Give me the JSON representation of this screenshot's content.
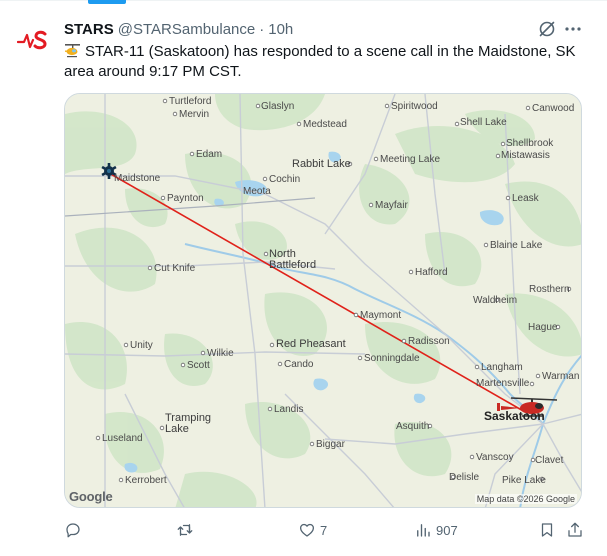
{
  "tweet": {
    "display_name": "STARS",
    "handle": "@STARSambulance",
    "separator": "·",
    "time": "10h",
    "text": "STAR-11 (Saskatoon) has responded to a scene call in the Maidstone, SK area around 9:17 PM CST.",
    "brand_color": "#e31b23"
  },
  "map": {
    "places": {
      "turtleford": "Turtleford",
      "mervin": "Mervin",
      "glaslyn": "Glaslyn",
      "spiritwood": "Spiritwood",
      "canwood": "Canwood",
      "medstead": "Medstead",
      "shell_lake": "Shell Lake",
      "shellbrook": "Shellbrook",
      "mistawasis": "Mistawasis",
      "edam": "Edam",
      "rabbit_lake": "Rabbit Lake",
      "meeting_lake": "Meeting Lake",
      "maidstone": "Maidstone",
      "cochin": "Cochin",
      "meota": "Meota",
      "paynton": "Paynton",
      "mayfair": "Mayfair",
      "leask": "Leask",
      "north_battleford": "North\nBattleford",
      "blaine_lake": "Blaine Lake",
      "cut_knife": "Cut Knife",
      "hafford": "Hafford",
      "rosthern": "Rosthern",
      "waldheim": "Waldheim",
      "maymont": "Maymont",
      "hague": "Hague",
      "radisson": "Radisson",
      "unity": "Unity",
      "wilkie": "Wilkie",
      "red_pheasant": "Red Pheasant",
      "sonningdale": "Sonningdale",
      "scott": "Scott",
      "cando": "Cando",
      "langham": "Langham",
      "martensville": "Martensville",
      "warman": "Warman",
      "landis": "Landis",
      "saskatoon": "Saskatoon",
      "asquith": "Asquith",
      "tramping_lake": "Tramping\nLake",
      "luseland": "Luseland",
      "biggar": "Biggar",
      "vanscoy": "Vanscoy",
      "clavet": "Clavet",
      "kerrobert": "Kerrobert",
      "delisle": "Delisle",
      "pike_lake": "Pike Lake"
    },
    "logo": "Google",
    "attribution": "Map data ©2026 Google",
    "route_color": "#e0221a",
    "icons": [
      "scene-marker-icon",
      "helicopter-icon"
    ]
  },
  "actions": {
    "reply_count": "",
    "retweet_count": "",
    "like_count": "7",
    "views_count": "907"
  }
}
